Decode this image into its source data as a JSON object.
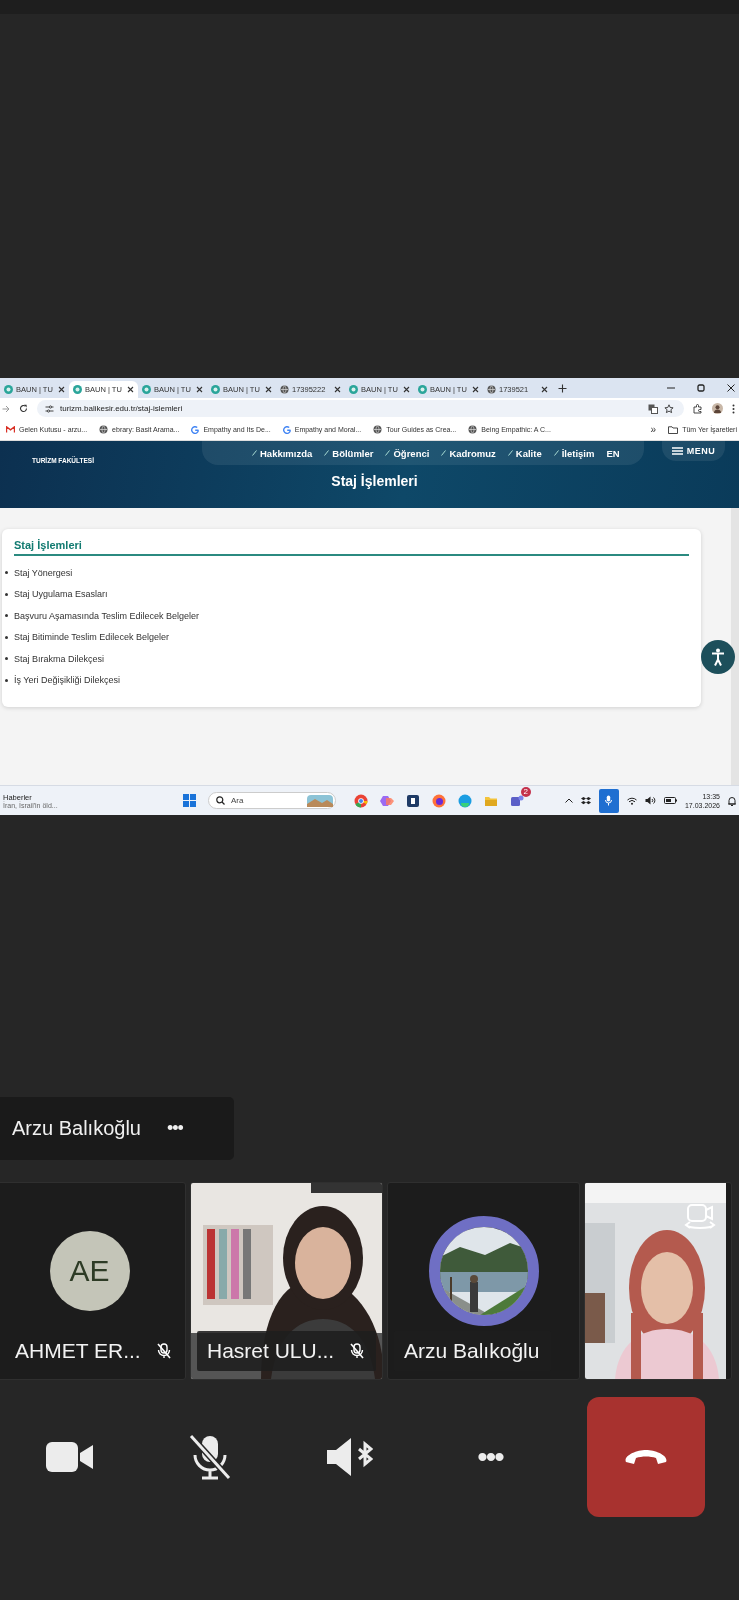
{
  "shared_screen": {
    "browser_tabs": [
      {
        "label": "BAUN | TU",
        "kind": "site",
        "selected": false
      },
      {
        "label": "BAUN | TU",
        "kind": "site",
        "selected": true
      },
      {
        "label": "BAUN | TU",
        "kind": "site",
        "selected": false
      },
      {
        "label": "BAUN | TU",
        "kind": "site",
        "selected": false
      },
      {
        "label": "17395222",
        "kind": "globe",
        "selected": false
      },
      {
        "label": "BAUN | TU",
        "kind": "site",
        "selected": false
      },
      {
        "label": "BAUN | TU",
        "kind": "site",
        "selected": false
      },
      {
        "label": "1739521",
        "kind": "globe",
        "selected": false
      }
    ],
    "address": "turizm.balikesir.edu.tr/staj-islemleri",
    "bookmarks": [
      {
        "label": "Gelen Kutusu - arzu...",
        "kind": "mail"
      },
      {
        "label": "ebrary: Basit Arama...",
        "kind": "globe"
      },
      {
        "label": "Empathy and Its De...",
        "kind": "google"
      },
      {
        "label": "Empathy and Moral...",
        "kind": "google"
      },
      {
        "label": "Tour Guides as Crea...",
        "kind": "globe"
      },
      {
        "label": "Being Empathic: A C...",
        "kind": "globe"
      }
    ],
    "bookmarks_more": "»",
    "all_bookmarks": "Tüm Yer İşaretleri",
    "site": {
      "faculty": "TURİZM FAKÜLTESİ",
      "nav": [
        "Hakkımızda",
        "Bölümler",
        "Öğrenci",
        "Kadromuz",
        "Kalite",
        "İletişim"
      ],
      "language": "EN",
      "menu": "MENU",
      "page_title": "Staj İşlemleri",
      "section_title": "Staj İşlemleri",
      "links": [
        "Staj Yönergesi",
        "Staj Uygulama Esasları",
        "Başvuru Aşamasında Teslim Edilecek Belgeler",
        "Staj Bitiminde Teslim Edilecek Belgeler",
        "Staj Bırakma Dilekçesi",
        "İş Yeri Değişikliği Dilekçesi"
      ]
    },
    "taskbar": {
      "news_title": "Haberler",
      "news_text": "İran, İsrail'in öld...",
      "search_placeholder": "Ara",
      "teams_badge": "2",
      "time": "13:35",
      "date": "17.03.2026"
    }
  },
  "presenter": {
    "name": "Arzu Balıkoğlu",
    "more": "•••"
  },
  "participants": [
    {
      "kind": "initials",
      "name": "AHMET ER...",
      "initials": "AE",
      "muted": true
    },
    {
      "kind": "video",
      "name": "Hasret ULU...",
      "muted": true
    },
    {
      "kind": "avatar",
      "name": "Arzu Balıkoğlu",
      "muted": false
    },
    {
      "kind": "self"
    }
  ],
  "call_controls": [
    {
      "kind": "camera"
    },
    {
      "kind": "mic",
      "muted": true
    },
    {
      "kind": "speaker"
    },
    {
      "kind": "more",
      "label": "•••"
    },
    {
      "kind": "hangup"
    }
  ]
}
